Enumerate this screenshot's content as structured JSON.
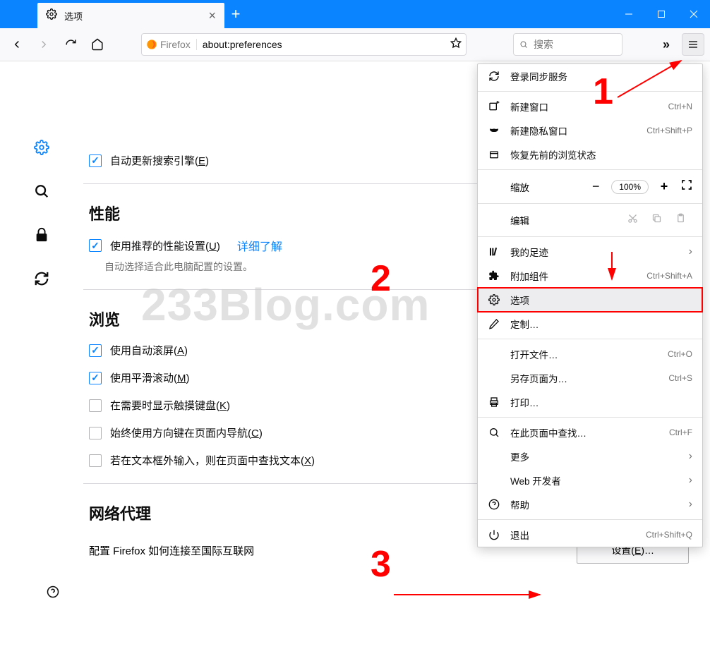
{
  "tab": {
    "title": "选项"
  },
  "urlbar": {
    "brand": "Firefox",
    "url": "about:preferences"
  },
  "searchbox": {
    "placeholder": "搜索"
  },
  "prefs": {
    "auto_update_search": "自动更新搜索引擎(E)",
    "section_performance": "性能",
    "use_recommended": "使用推荐的性能设置(U)",
    "learn_more": "详细了解",
    "auto_select_desc": "自动选择适合此电脑配置的设置。",
    "section_browsing": "浏览",
    "use_autoscroll": "使用自动滚屏(A)",
    "use_smooth": "使用平滑滚动(M)",
    "touch_keyboard": "在需要时显示触摸键盘(K)",
    "caret_nav": "始终使用方向键在页面内导航(C)",
    "search_on_type": "若在文本框外输入，则在页面中查找文本(X)",
    "section_proxy": "网络代理",
    "proxy_desc": "配置 Firefox 如何连接至国际互联网",
    "settings_btn": "设置(E)…"
  },
  "menu": {
    "sync": "登录同步服务",
    "new_window": "新建窗口",
    "new_window_sc": "Ctrl+N",
    "new_private": "新建隐私窗口",
    "new_private_sc": "Ctrl+Shift+P",
    "restore": "恢复先前的浏览状态",
    "zoom": "缩放",
    "zoom_val": "100%",
    "edit": "编辑",
    "library": "我的足迹",
    "addons": "附加组件",
    "addons_sc": "Ctrl+Shift+A",
    "options": "选项",
    "customize": "定制…",
    "open_file": "打开文件…",
    "open_file_sc": "Ctrl+O",
    "save_as": "另存页面为…",
    "save_as_sc": "Ctrl+S",
    "print": "打印…",
    "find": "在此页面中查找…",
    "find_sc": "Ctrl+F",
    "more": "更多",
    "webdev": "Web 开发者",
    "help": "帮助",
    "quit": "退出",
    "quit_sc": "Ctrl+Shift+Q"
  },
  "annotations": {
    "n1": "1",
    "n2": "2",
    "n3": "3"
  },
  "watermark": "233Blog.com"
}
